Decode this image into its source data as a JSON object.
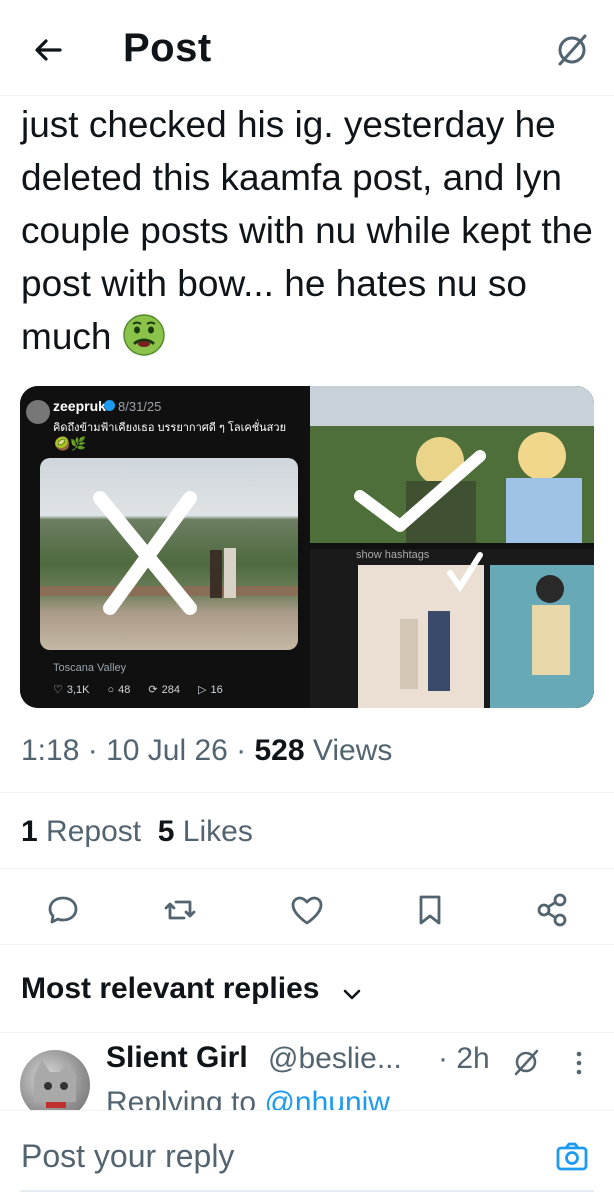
{
  "header": {
    "title": "Post"
  },
  "tweet": {
    "text": "just checked his ig. yesterday he deleted this kaamfa post, and lyn couple posts with nu while kept the post with bow... he hates nu so much",
    "emoji": "nauseated-face"
  },
  "embedded": {
    "username": "zeepruk",
    "date": "8/31/25",
    "thai_text": "คิดถึงข้ามฟ้าเคียงเธอ บรรยากาศดี ๆ โลเคชั่นสวย",
    "location": "Toscana Valley",
    "stats": {
      "likes": "3,1K",
      "comments": "48",
      "reposts": "284",
      "shares": "16"
    },
    "hashtags_label": "show hashtags"
  },
  "meta": {
    "time": "1:18",
    "date": "10 Jul 26",
    "views_count": "528",
    "views_label": "Views"
  },
  "counts": {
    "reposts_count": "1",
    "reposts_label": "Repost",
    "likes_count": "5",
    "likes_label": "Likes"
  },
  "replies": {
    "header": "Most relevant replies",
    "items": [
      {
        "name": "Slient Girl",
        "handle": "@beslie...",
        "time": "2h",
        "replying_prefix": "Replying to",
        "replying_to": "@nhuniw"
      }
    ]
  },
  "composer": {
    "placeholder": "Post your reply"
  },
  "colors": {
    "accent": "#1d9bf0",
    "text": "#0f1419",
    "muted": "#536471"
  }
}
